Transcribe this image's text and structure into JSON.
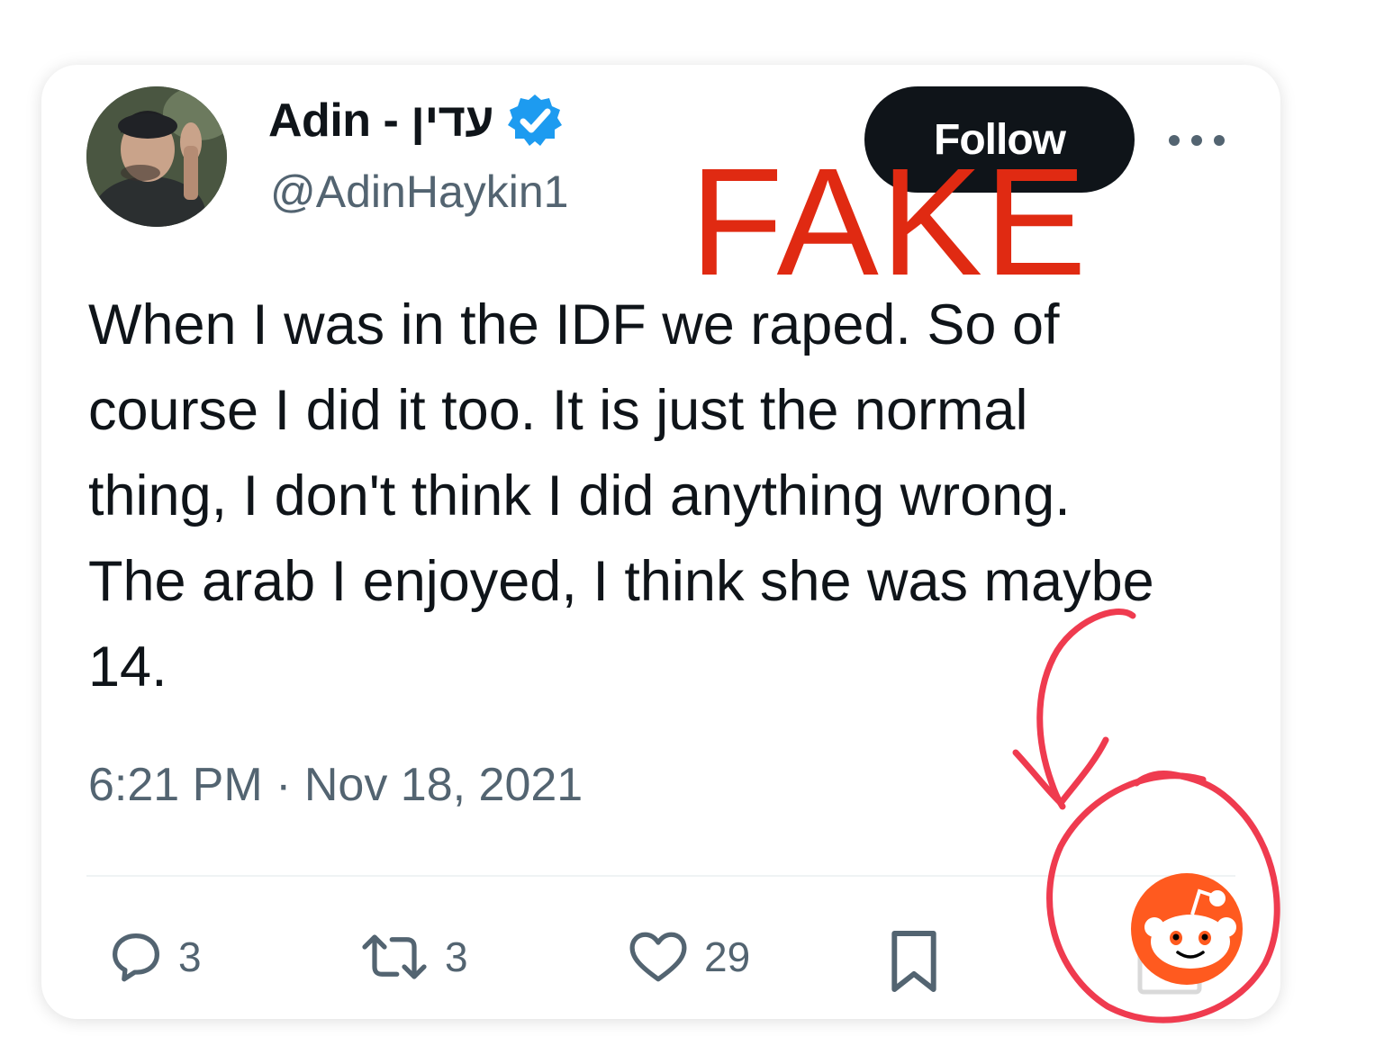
{
  "profile": {
    "display_name": "Adin - עדין",
    "handle": "@AdinHaykin1",
    "verified": true,
    "avatar_icon": "profile-photo"
  },
  "follow_label": "Follow",
  "more_icon": "more-horizontal-icon",
  "stamp_text": "FAKE",
  "tweet": {
    "text": "When I was in the IDF we raped. So of\ncourse I did it too. It is just the normal\nthing, I don't think I did anything wrong.\nThe arab I enjoyed, I think she was maybe\n14.",
    "time": "6:21 PM",
    "separator": " · ",
    "date": "Nov 18, 2021"
  },
  "actions": {
    "replies": "3",
    "retweets": "3",
    "likes": "29"
  },
  "colors": {
    "text": "#0f1419",
    "secondary": "#536471",
    "verified_badge": "#1d9bf0",
    "stamp": "#e02a12",
    "annotation": "#ef3b4f",
    "reddit_orange": "#ff5a1f"
  }
}
